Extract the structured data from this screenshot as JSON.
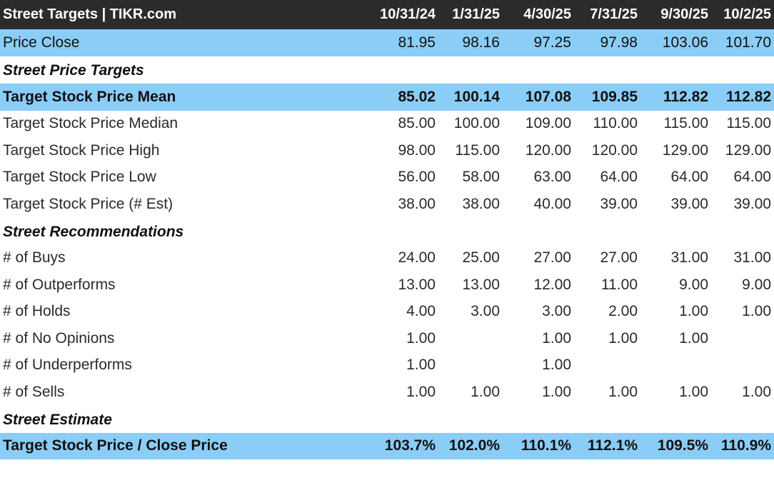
{
  "header": {
    "title": "Street Targets | TIKR.com",
    "dates": [
      "10/31/24",
      "1/31/25",
      "4/30/25",
      "7/31/25",
      "9/30/25",
      "10/2/25"
    ]
  },
  "price_close": {
    "label": "Price Close",
    "values": [
      "81.95",
      "98.16",
      "97.25",
      "97.98",
      "103.06",
      "101.70"
    ]
  },
  "sections": {
    "targets": "Street Price Targets",
    "recommendations": "Street Recommendations",
    "estimate": "Street Estimate"
  },
  "target_rows": [
    {
      "label": "Target Stock Price Mean",
      "values": [
        "85.02",
        "100.14",
        "107.08",
        "109.85",
        "112.82",
        "112.82"
      ]
    },
    {
      "label": "Target Stock Price Median",
      "values": [
        "85.00",
        "100.00",
        "109.00",
        "110.00",
        "115.00",
        "115.00"
      ]
    },
    {
      "label": "Target Stock Price High",
      "values": [
        "98.00",
        "115.00",
        "120.00",
        "120.00",
        "129.00",
        "129.00"
      ]
    },
    {
      "label": "Target Stock Price Low",
      "values": [
        "56.00",
        "58.00",
        "63.00",
        "64.00",
        "64.00",
        "64.00"
      ]
    },
    {
      "label": "Target Stock Price (# Est)",
      "values": [
        "38.00",
        "38.00",
        "40.00",
        "39.00",
        "39.00",
        "39.00"
      ]
    }
  ],
  "recommendation_rows": [
    {
      "label": "# of Buys",
      "values": [
        "24.00",
        "25.00",
        "27.00",
        "27.00",
        "31.00",
        "31.00"
      ]
    },
    {
      "label": "# of Outperforms",
      "values": [
        "13.00",
        "13.00",
        "12.00",
        "11.00",
        "9.00",
        "9.00"
      ]
    },
    {
      "label": "# of Holds",
      "values": [
        "4.00",
        "3.00",
        "3.00",
        "2.00",
        "1.00",
        "1.00"
      ]
    },
    {
      "label": "# of No Opinions",
      "values": [
        "1.00",
        "",
        "1.00",
        "1.00",
        "1.00",
        ""
      ]
    },
    {
      "label": "# of Underperforms",
      "values": [
        "1.00",
        "",
        "1.00",
        "",
        "",
        ""
      ]
    },
    {
      "label": "# of Sells",
      "values": [
        "1.00",
        "1.00",
        "1.00",
        "1.00",
        "1.00",
        "1.00"
      ]
    }
  ],
  "estimate_row": {
    "label": "Target Stock Price / Close Price",
    "values": [
      "103.7%",
      "102.0%",
      "110.1%",
      "112.1%",
      "109.5%",
      "110.9%"
    ]
  },
  "colors": {
    "header_bg": "#2b2b2b",
    "highlight_bg": "#8acdf7"
  }
}
